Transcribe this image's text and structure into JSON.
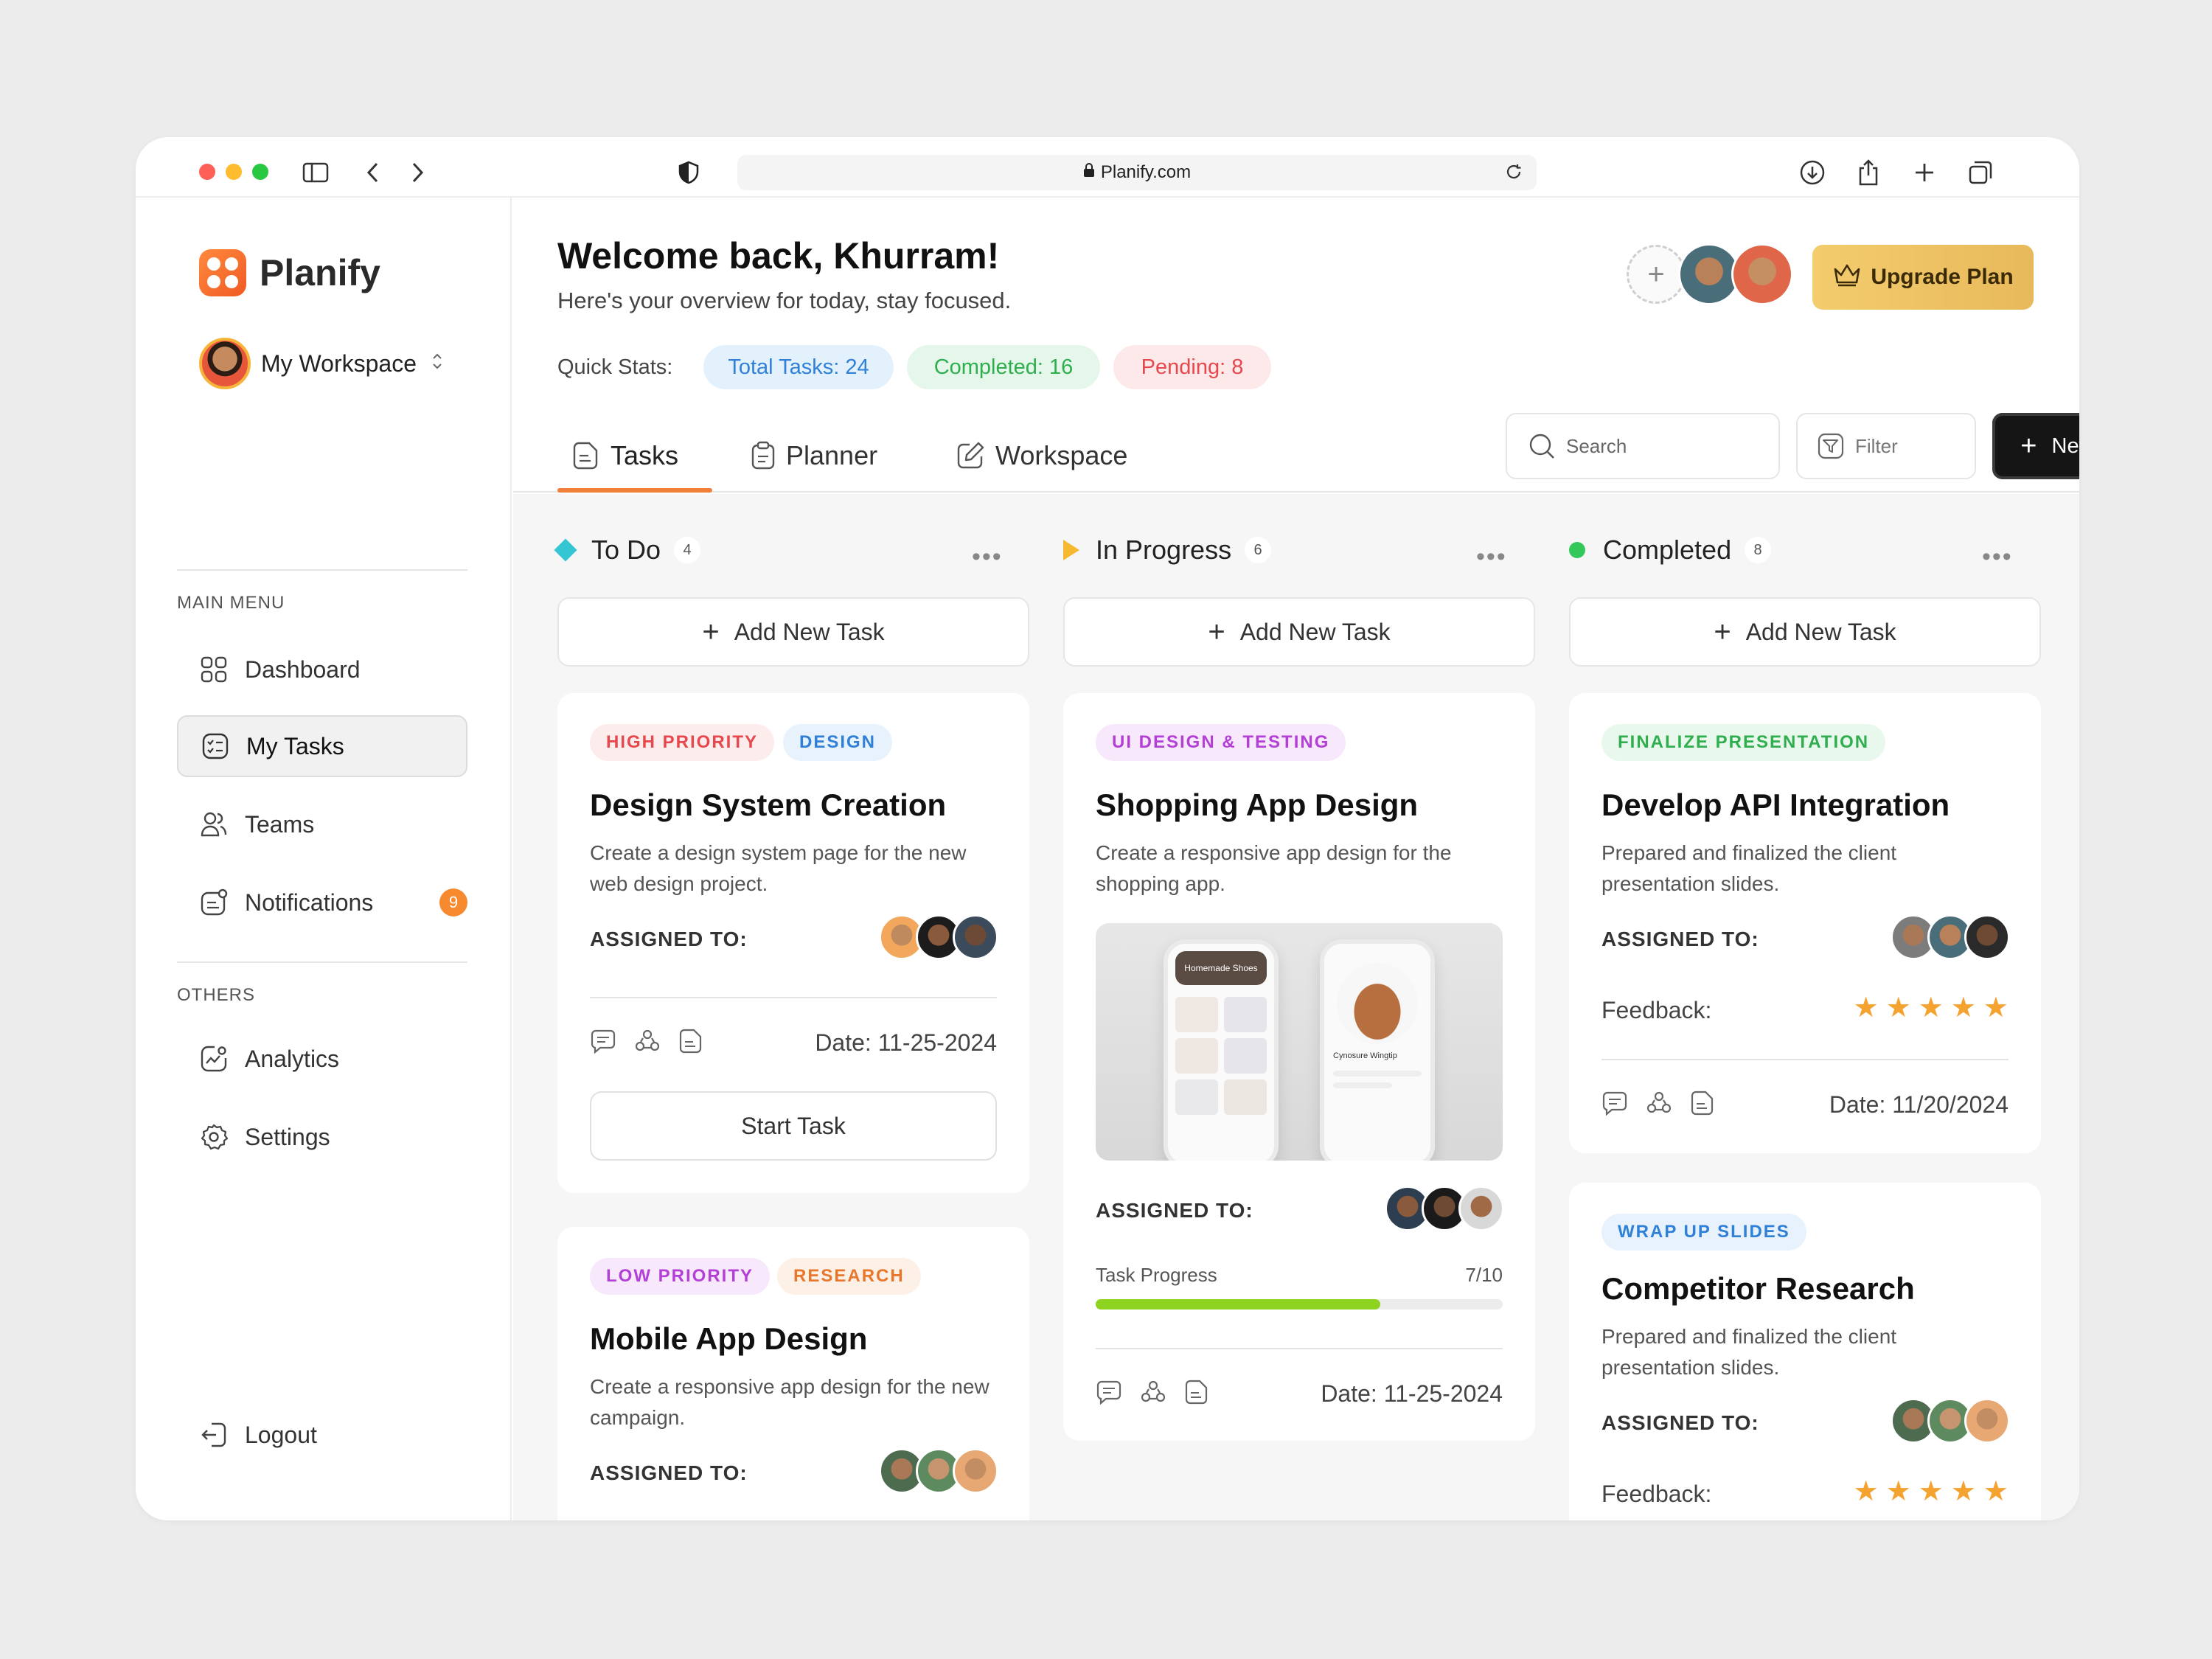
{
  "browser": {
    "url": "Planify.com",
    "traffic_colors": [
      "#fe5f57",
      "#febc2e",
      "#28c840"
    ]
  },
  "sidebar": {
    "brand": "Planify",
    "brand_color": "#f47232",
    "workspace": "My Workspace",
    "main_menu_label": "MAIN MENU",
    "others_label": "OTHERS",
    "items": [
      {
        "label": "Dashboard",
        "icon": "grid-icon"
      },
      {
        "label": "My Tasks",
        "icon": "tasks-icon",
        "active": true
      },
      {
        "label": "Teams",
        "icon": "users-icon"
      },
      {
        "label": "Notifications",
        "icon": "bell-icon",
        "badge": "9"
      }
    ],
    "others": [
      {
        "label": "Analytics",
        "icon": "analytics-icon"
      },
      {
        "label": "Settings",
        "icon": "gear-icon"
      }
    ],
    "logout": "Logout"
  },
  "header": {
    "welcome": "Welcome back, Khurram!",
    "subtitle": "Here's your overview for today, stay focused.",
    "quick_stats_label": "Quick Stats:",
    "stats": {
      "total": "Total Tasks: 24",
      "completed": "Completed: 16",
      "pending": "Pending: 8"
    },
    "upgrade": "Upgrade Plan"
  },
  "tabs": [
    {
      "label": "Tasks",
      "icon": "doc-icon",
      "active": true
    },
    {
      "label": "Planner",
      "icon": "clipboard-icon"
    },
    {
      "label": "Workspace",
      "icon": "edit-icon"
    }
  ],
  "toolbar": {
    "search_placeholder": "Search",
    "filter": "Filter",
    "new_task": "New Task"
  },
  "columns": [
    {
      "title": "To Do",
      "count": "4",
      "marker_color": "#34c6d3",
      "add_label": "Add New Task",
      "cards": [
        {
          "tags": [
            {
              "text": "HIGH PRIORITY",
              "color": "#e5484d",
              "bg": "#fdecec"
            },
            {
              "text": "DESIGN",
              "color": "#2f80d6",
              "bg": "#e8f2fd"
            }
          ],
          "title": "Design System Creation",
          "desc": "Create a design system page for the new web design project.",
          "assigned": "ASSIGNED TO:",
          "date": "Date: 11-25-2024",
          "button": "Start Task"
        },
        {
          "tags": [
            {
              "text": "LOW PRIORITY",
              "color": "#b43fd6",
              "bg": "#f7e9fb"
            },
            {
              "text": "RESEARCH",
              "color": "#e8772e",
              "bg": "#fdf0e6"
            }
          ],
          "title": "Mobile App Design",
          "desc": "Create a responsive app design for the new campaign.",
          "assigned": "ASSIGNED TO:"
        }
      ]
    },
    {
      "title": "In Progress",
      "count": "6",
      "marker_color": "#f5b82e",
      "add_label": "Add New Task",
      "cards": [
        {
          "tags": [
            {
              "text": "UI DESIGN & TESTING",
              "color": "#b43fd6",
              "bg": "#f7e9fb"
            }
          ],
          "title": "Shopping App Design",
          "desc": "Create a responsive app design for the shopping app.",
          "assigned": "ASSIGNED TO:",
          "progress_label": "Task Progress",
          "progress_text": "7/10",
          "progress": 0.7,
          "date": "Date: 11-25-2024",
          "mock_header": "Homemade Shoes",
          "mock_product": "Cynosure Wingtip"
        }
      ]
    },
    {
      "title": "Completed",
      "count": "8",
      "marker_color": "#34c759",
      "add_label": "Add New Task",
      "cards": [
        {
          "tags": [
            {
              "text": "FINALIZE PRESENTATION",
              "color": "#2fae4e",
              "bg": "#e9f8ed"
            }
          ],
          "title": "Develop API Integration",
          "desc": "Prepared and finalized the client presentation slides.",
          "assigned": "ASSIGNED TO:",
          "feedback": "Feedback:",
          "rating": 5,
          "date": "Date: 11/20/2024"
        },
        {
          "tags": [
            {
              "text": "WRAP UP SLIDES",
              "color": "#2f80d6",
              "bg": "#e8f2fd"
            }
          ],
          "title": "Competitor Research",
          "desc": "Prepared and finalized the client presentation slides.",
          "assigned": "ASSIGNED TO:",
          "feedback": "Feedback:",
          "rating": 5
        }
      ]
    }
  ]
}
